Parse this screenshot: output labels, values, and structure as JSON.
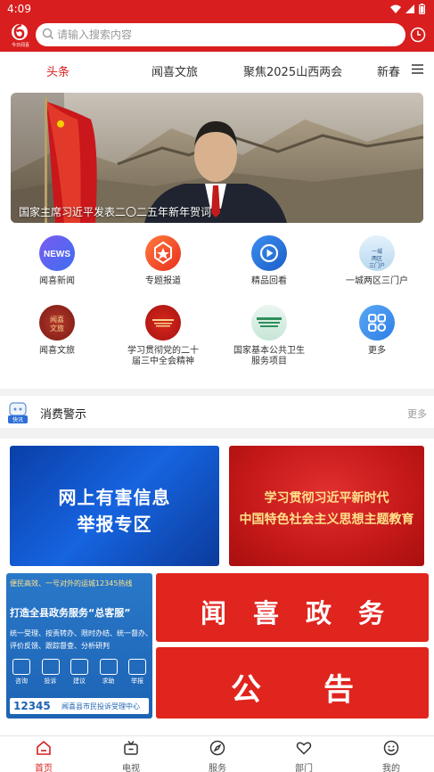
{
  "status_bar": {
    "time": "4:09"
  },
  "header": {
    "logo_text": "今日闻喜",
    "search_placeholder": "请输入搜索内容"
  },
  "tabs": [
    {
      "label": "头条",
      "active": true
    },
    {
      "label": "闻喜文旅",
      "active": false
    },
    {
      "label": "聚焦2025山西两会",
      "active": false
    },
    {
      "label": "新春",
      "active": false
    }
  ],
  "banner": {
    "caption": "国家主席习近平发表二〇二五年新年贺词"
  },
  "grid": [
    {
      "label": "闻喜新闻",
      "icon": "news-icon"
    },
    {
      "label": "专题报道",
      "icon": "badge-icon"
    },
    {
      "label": "精品回看",
      "icon": "replay-icon"
    },
    {
      "label": "一城两区三门户",
      "icon": "city-icon",
      "icon_text": "一城两区三门户"
    },
    {
      "label": "闻喜文旅",
      "icon": "culture-icon",
      "icon_text": "闻喜文旅"
    },
    {
      "label": "学习贯彻党的二十届三中全会精神",
      "icon": "study-icon"
    },
    {
      "label": "国家基本公共卫生服务项目",
      "icon": "health-icon"
    },
    {
      "label": "更多",
      "icon": "more-apps-icon"
    }
  ],
  "section": {
    "icon_text": "快讯",
    "title": "消费警示",
    "more": "更多"
  },
  "cards": {
    "report": {
      "line1": "网上有害信息",
      "line2": "举报专区"
    },
    "study": {
      "line1": "学习贯彻习近平新时代",
      "line2": "中国特色社会主义思想主题教育"
    },
    "hotline": {
      "top": "便民高效、一号对外的运城12345热线",
      "big": "打造全县政务服务“总客服”",
      "l1": "统一受理、按责转办、限时办结、统一督办、",
      "l2": "评价反馈、跟踪督查、分析研判",
      "icons": [
        "咨询",
        "投诉",
        "建议",
        "求助",
        "举报"
      ],
      "number": "12345",
      "footer": "闻喜县市民投诉受理中心"
    },
    "affairs": "闻喜政务",
    "notice": "公告"
  },
  "bottom_nav": [
    {
      "label": "首页",
      "icon": "home-icon",
      "active": true
    },
    {
      "label": "电视",
      "icon": "tv-icon",
      "active": false
    },
    {
      "label": "服务",
      "icon": "compass-icon",
      "active": false
    },
    {
      "label": "部门",
      "icon": "heart-icon",
      "active": false
    },
    {
      "label": "我的",
      "icon": "smile-icon",
      "active": false
    }
  ],
  "colors": {
    "brand": "#d81e1e",
    "accent_blue": "#1d63b4"
  }
}
